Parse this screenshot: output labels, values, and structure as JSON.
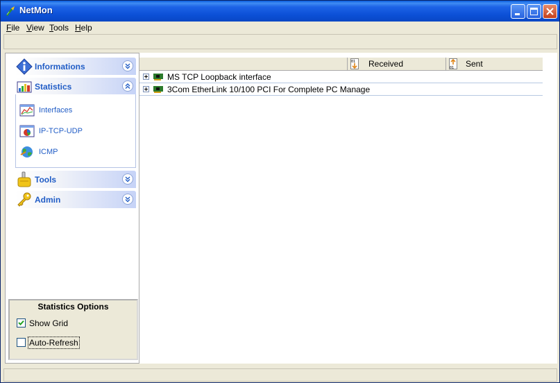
{
  "window": {
    "title": "NetMon",
    "colors": {
      "titlebar": "#0b4fd6",
      "close_button": "#c4401c",
      "group_label": "#215dc6"
    }
  },
  "menu": [
    {
      "label_ul": "F",
      "label_rest": "ile"
    },
    {
      "label_ul": "V",
      "label_rest": "iew"
    },
    {
      "label_ul": "T",
      "label_rest": "ools"
    },
    {
      "label_ul": "H",
      "label_rest": "elp"
    }
  ],
  "sidebar": {
    "groups": [
      {
        "label": "Informations",
        "icon": "info-icon",
        "state": "collapsed"
      },
      {
        "label": "Statistics",
        "icon": "bar-chart-icon",
        "state": "expanded",
        "items": [
          {
            "label": "Interfaces",
            "icon": "line-chart-icon"
          },
          {
            "label": "IP-TCP-UDP",
            "icon": "pie-chart-icon"
          },
          {
            "label": "ICMP",
            "icon": "globe-icon"
          }
        ]
      },
      {
        "label": "Tools",
        "icon": "gear-hand-icon",
        "state": "collapsed"
      },
      {
        "label": "Admin",
        "icon": "key-icon",
        "state": "collapsed"
      }
    ],
    "options": {
      "title": "Statistics  Options",
      "show_grid": {
        "label": "Show Grid",
        "checked": true
      },
      "auto_refresh": {
        "label": "Auto-Refresh",
        "checked": false
      }
    }
  },
  "main": {
    "columns": [
      {
        "label": "Received",
        "icon": "sort-down-icon"
      },
      {
        "label": "Sent",
        "icon": "sort-up-icon"
      }
    ],
    "interfaces": [
      {
        "label": "MS TCP Loopback interface"
      },
      {
        "label": "3Com EtherLink 10/100 PCI For Complete PC Manage"
      }
    ]
  }
}
